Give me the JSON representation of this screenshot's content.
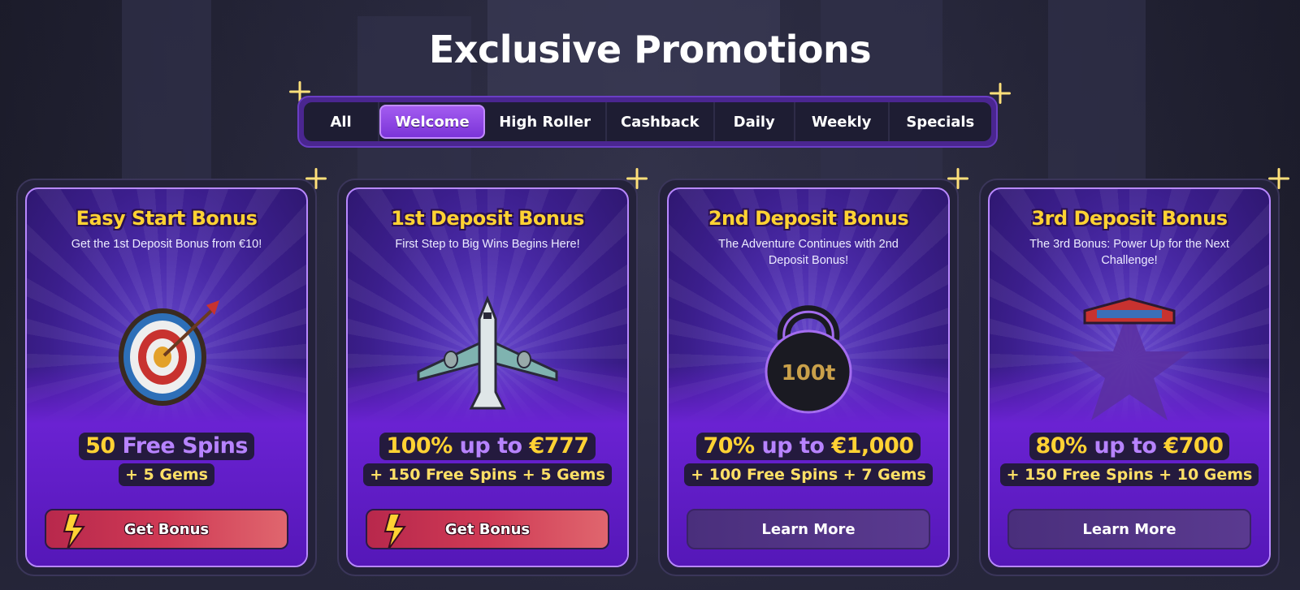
{
  "page": {
    "title": "Exclusive Promotions"
  },
  "tabs": [
    {
      "label": "All",
      "active": false
    },
    {
      "label": "Welcome",
      "active": true
    },
    {
      "label": "High Roller",
      "active": false
    },
    {
      "label": "Cashback",
      "active": false
    },
    {
      "label": "Daily",
      "active": false
    },
    {
      "label": "Weekly",
      "active": false
    },
    {
      "label": "Specials",
      "active": false
    }
  ],
  "cards": [
    {
      "title": "Easy Start Bonus",
      "subtitle": "Get the 1st Deposit Bonus from €10!",
      "icon": "target-icon",
      "main_a": "50 ",
      "main_b": "Free Spins",
      "extra": "+ 5 Gems",
      "button": "Get Bonus",
      "button_style": "get"
    },
    {
      "title": "1st Deposit Bonus",
      "subtitle": "First Step to Big Wins Begins Here!",
      "icon": "airplane-icon",
      "main_a": "100% ",
      "main_b": "up to",
      "main_c": " €777",
      "extra": "+ 150 Free Spins + 5 Gems",
      "button": "Get Bonus",
      "button_style": "get"
    },
    {
      "title": "2nd Deposit Bonus",
      "subtitle": "The Adventure Continues with 2nd Deposit Bonus!",
      "icon": "kettlebell-icon",
      "icon_label": "100t",
      "main_a": "70% ",
      "main_b": "up to",
      "main_c": " €1,000",
      "extra": "+ 100 Free Spins + 7 Gems",
      "button": "Learn More",
      "button_style": "learn"
    },
    {
      "title": "3rd Deposit Bonus",
      "subtitle": "The 3rd Bonus: Power Up for the Next Challenge!",
      "icon": "star-shield-icon",
      "main_a": "80% ",
      "main_b": "up to",
      "main_c": " €700",
      "extra": "+ 150 Free Spins + 10 Gems",
      "button": "Learn More",
      "button_style": "learn"
    }
  ],
  "colors": {
    "background": "#26263a",
    "accent_yellow": "#ffd233",
    "accent_purple": "#b783ff",
    "tab_active": "#8d45e4",
    "button_get": "#cf3a55",
    "button_learn": "#5a3a90"
  }
}
